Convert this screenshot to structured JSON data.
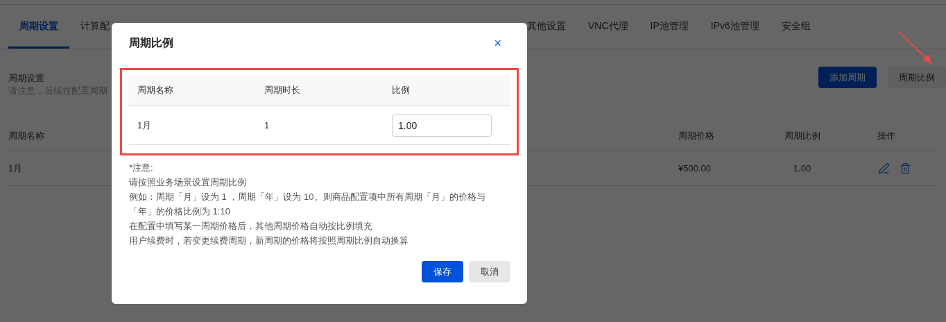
{
  "tabs": [
    {
      "label": "周期设置",
      "selected": true
    },
    {
      "label": "计算配",
      "selected": false
    },
    {
      "label": "其他设置",
      "selected": false
    },
    {
      "label": "VNC代理",
      "selected": false
    },
    {
      "label": "IP池管理",
      "selected": false
    },
    {
      "label": "IPv6池管理",
      "selected": false
    },
    {
      "label": "安全组",
      "selected": false
    }
  ],
  "section": {
    "title": "周期设置",
    "subtitle": "请注意，后续在配置周期",
    "buttons": [
      {
        "label": "添加周期",
        "kind": "primary"
      },
      {
        "label": "周期比例",
        "kind": "secondary"
      }
    ]
  },
  "table": {
    "columns": [
      "周期名称",
      "周期价格",
      "周期比例",
      "操作"
    ],
    "rows": [
      {
        "cells": [
          "1月",
          "¥500.00",
          "1.00"
        ]
      }
    ]
  },
  "modal": {
    "title": "周期比例",
    "close": "×",
    "table": {
      "columns": [
        "周期名称",
        "周期时长",
        "比例"
      ],
      "rows": [
        {
          "name": "1月",
          "duration": "1",
          "ratio": "1.00"
        }
      ]
    },
    "notes": [
      "*注意:",
      "请按照业务场景设置周期比例",
      "例如：周期「月」设为 1 ，周期「年」设为 10。则商品配置项中所有周期「月」的价格与「年」的价格比例为 1:10",
      "在配置中填写某一周期价格后，其他周期价格自动按比例填充",
      "用户续费时，若变更续费周期，新周期的价格将按照周期比例自动换算"
    ],
    "buttons": [
      {
        "label": "保存",
        "kind": "primary"
      },
      {
        "label": "取消",
        "kind": "secondary"
      }
    ]
  }
}
